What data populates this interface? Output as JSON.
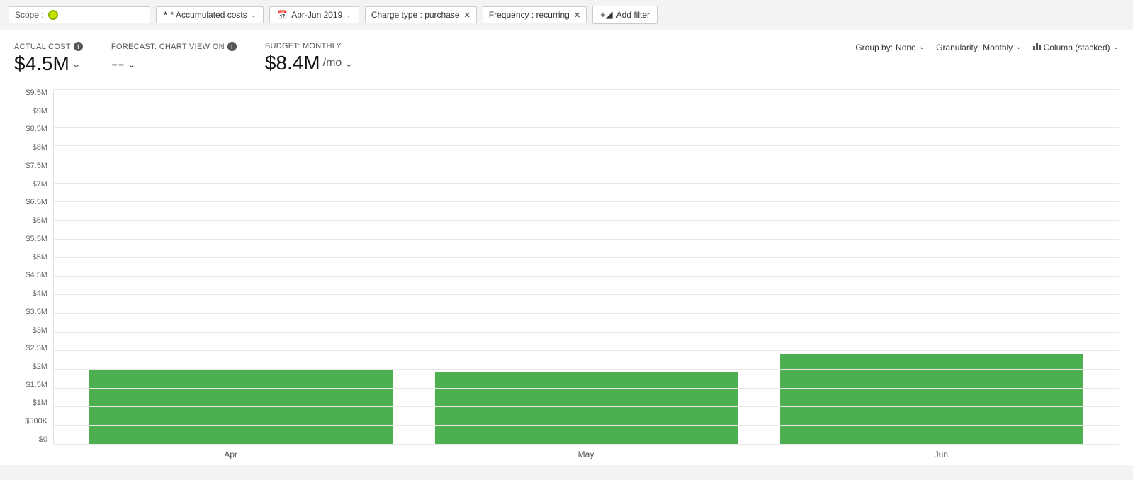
{
  "toolbar": {
    "scope_label": "Scope :",
    "accumulated_costs_label": "* Accumulated costs",
    "date_range_label": "Apr-Jun 2019",
    "charge_type_label": "Charge type : purchase",
    "frequency_label": "Frequency : recurring",
    "add_filter_label": "Add filter"
  },
  "metrics": {
    "actual_cost_label": "ACTUAL COST",
    "actual_cost_value": "$4.5M",
    "forecast_label": "FORECAST: CHART VIEW ON",
    "forecast_value": "--",
    "budget_label": "BUDGET: MONTHLY",
    "budget_value": "$8.4M",
    "budget_per_mo": "/mo"
  },
  "chart_controls": {
    "group_by_label": "Group by:",
    "group_by_value": "None",
    "granularity_label": "Granularity:",
    "granularity_value": "Monthly",
    "view_label": "Column (stacked)"
  },
  "y_axis": {
    "labels": [
      "$9.5M",
      "$9M",
      "$8.5M",
      "$8M",
      "$7.5M",
      "$7M",
      "$6.5M",
      "$6M",
      "$5.5M",
      "$5M",
      "$4.5M",
      "$4M",
      "$3.5M",
      "$3M",
      "$2.5M",
      "$2M",
      "$1.5M",
      "$1M",
      "$500K",
      "$0"
    ]
  },
  "x_axis": {
    "labels": [
      "Apr",
      "May",
      "Jun"
    ]
  },
  "bars": [
    {
      "month": "Apr",
      "height_pct": 21.0,
      "color": "#4caf50"
    },
    {
      "month": "May",
      "height_pct": 20.5,
      "color": "#4caf50"
    },
    {
      "month": "Jun",
      "height_pct": 25.5,
      "color": "#4caf50"
    }
  ]
}
